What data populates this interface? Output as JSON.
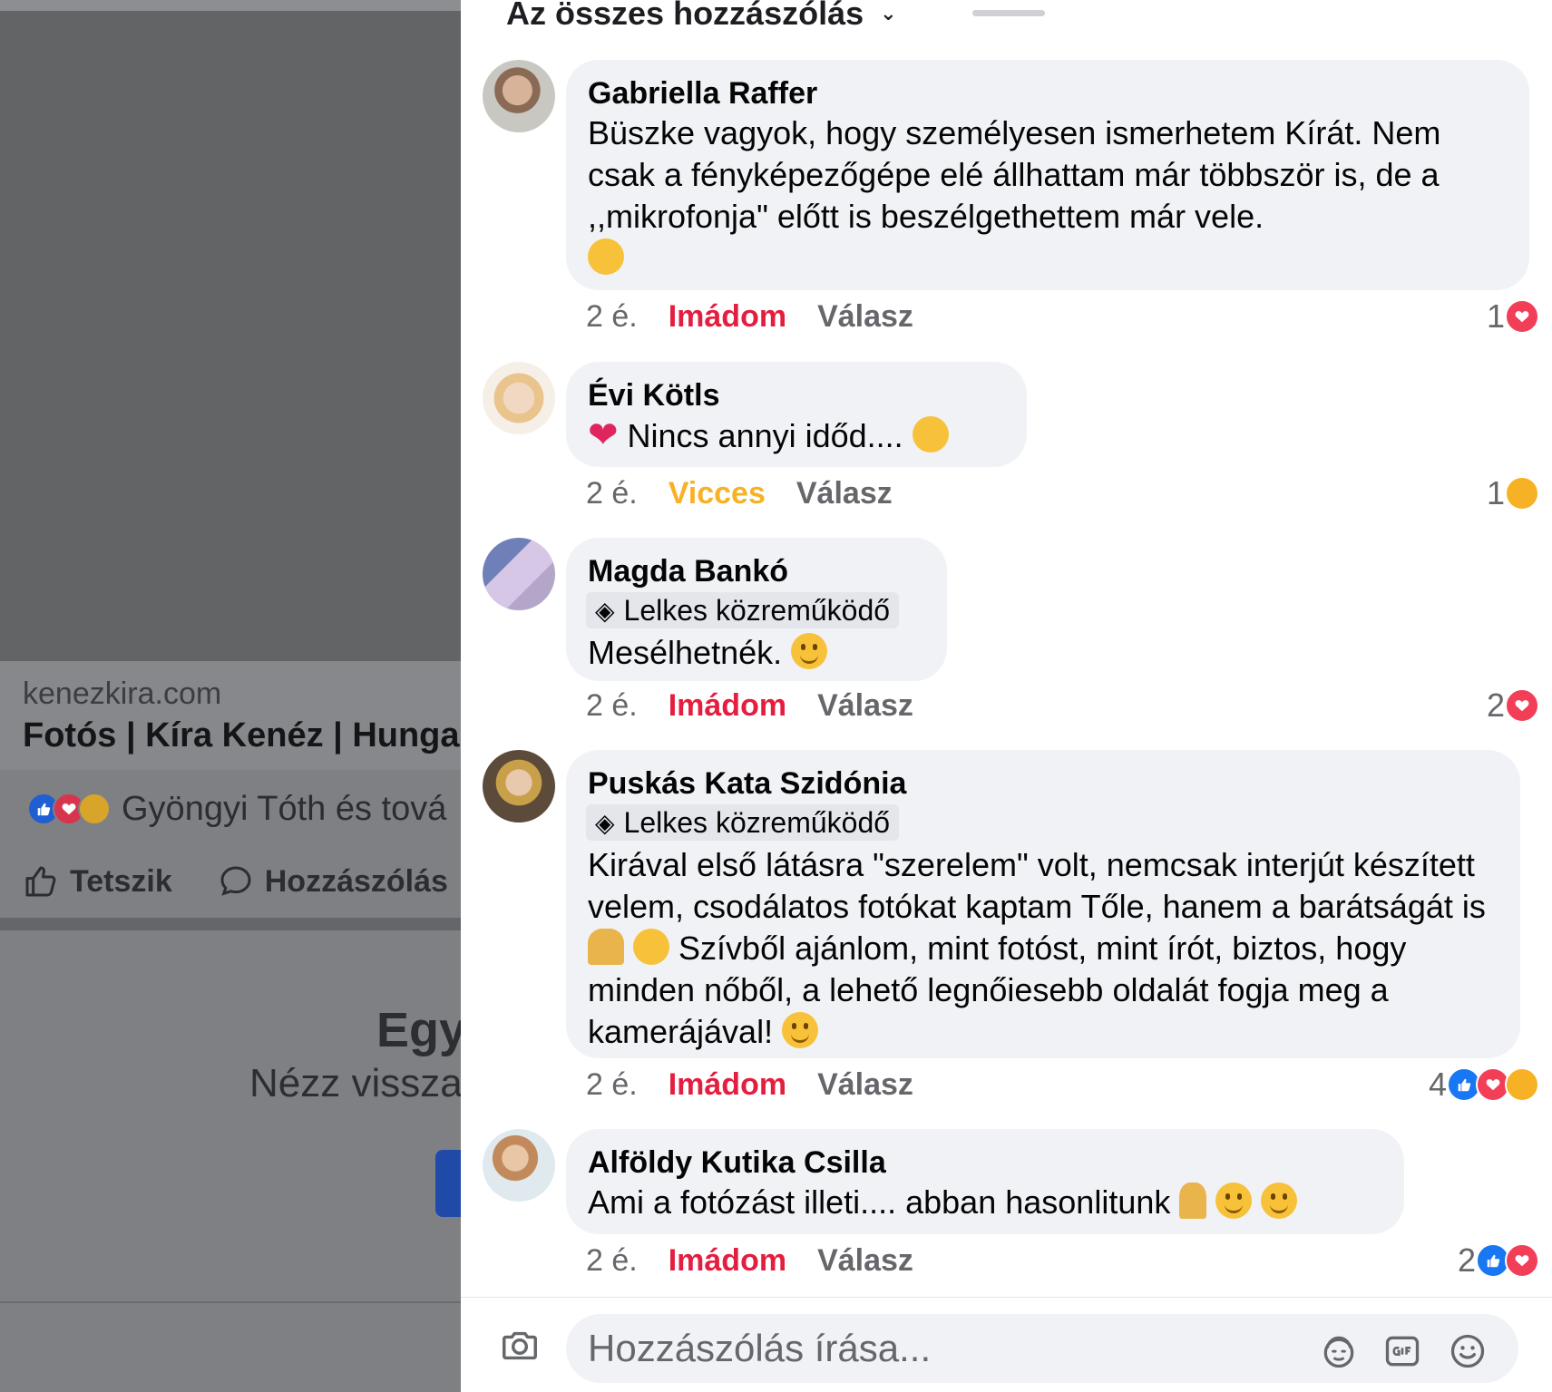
{
  "background": {
    "link_domain": "kenezkira.com",
    "link_title": "Fotós | Kíra Kenéz | Hunga",
    "reactions_text": "Gyöngyi Tóth és tová",
    "actions": {
      "like": "Tetszik",
      "comment": "Hozzászólás"
    },
    "heading": "Egy",
    "subheading": "Nézz vissza"
  },
  "sheet": {
    "header": "Az összes hozzászólás"
  },
  "comments": [
    {
      "author": "Gabriella Raffer",
      "text": "Büszke vagyok, hogy személyesen ismerhetem Kírát. Nem csak a fényképezőgépe elé állhattam már többször is, de a ,,mikrofonja\" előtt is beszélgethettem már vele.",
      "time": "2 é.",
      "reaction_label": "Imádom",
      "reply": "Válasz",
      "count": "1"
    },
    {
      "author": "Évi Kötls",
      "text": "Nincs annyi időd....",
      "time": "2 é.",
      "reaction_label": "Vicces",
      "reply": "Válasz",
      "count": "1"
    },
    {
      "author": "Magda Bankó",
      "badge": "Lelkes közreműködő",
      "text": "Mesélhetnék.",
      "time": "2 é.",
      "reaction_label": "Imádom",
      "reply": "Válasz",
      "count": "2"
    },
    {
      "author": "Puskás Kata Szidónia",
      "badge": "Lelkes közreműködő",
      "text_a": "Kirával első látásra \"szerelem\" volt, nemcsak interjút készített velem, csodálatos fotókat kaptam Tőle, hanem a barátságát is",
      "text_b": "Szívből ajánlom, mint fotóst, mint írót, biztos, hogy minden nőből, a lehető legnőiesebb oldalát fogja meg a kamerájával!",
      "time": "2 é.",
      "reaction_label": "Imádom",
      "reply": "Válasz",
      "count": "4"
    },
    {
      "author": "Alföldy Kutika Csilla",
      "text": "Ami a fotózást illeti.... abban hasonlitunk",
      "time": "2 é.",
      "reaction_label": "Imádom",
      "reply": "Válasz",
      "count": "2"
    }
  ],
  "composer": {
    "placeholder": "Hozzászólás írása..."
  },
  "colors": {
    "love": "#e41e3f",
    "haha": "#f7b125",
    "like": "#1877f2",
    "bubble": "#f0f2f5"
  }
}
